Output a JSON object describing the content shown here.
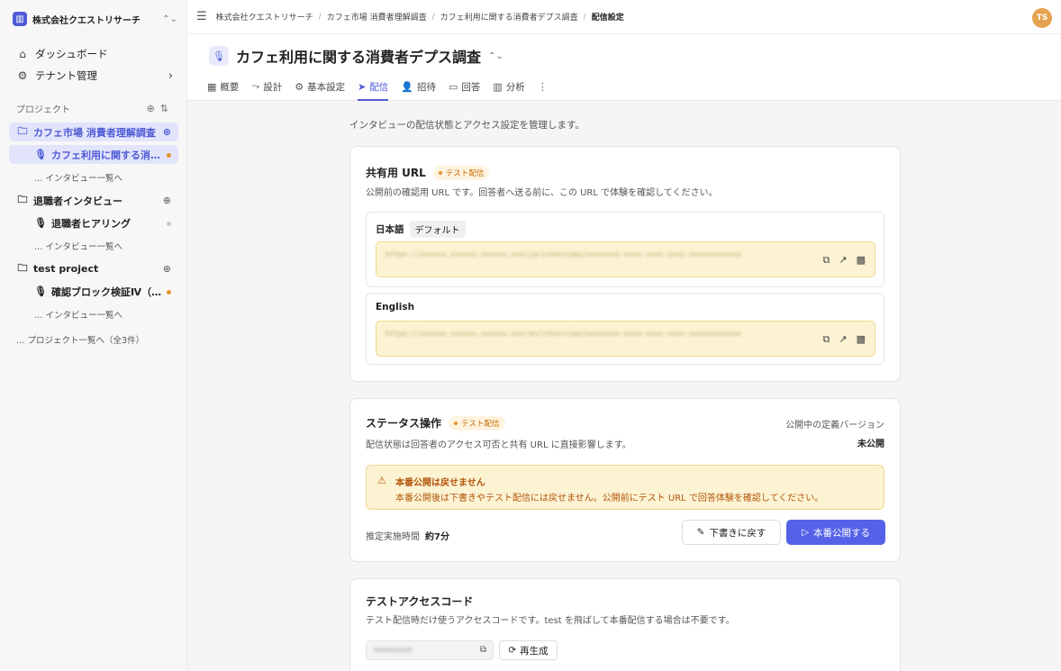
{
  "org": {
    "name": "株式会社クエストリサーチ"
  },
  "sidebar": {
    "nav": [
      {
        "label": "ダッシュボード"
      },
      {
        "label": "テナント管理"
      }
    ],
    "section_label": "プロジェクト",
    "projects": [
      {
        "label": "カフェ市場 消費者理解調査"
      },
      {
        "label": "カフェ利用に関する消…"
      },
      {
        "label": "… インタビュー一覧へ"
      },
      {
        "label": "退職者インタビュー"
      },
      {
        "label": "退職者ヒアリング"
      },
      {
        "label": "… インタビュー一覧へ"
      },
      {
        "label": "test project"
      },
      {
        "label": "確認ブロック検証Ⅳ（…"
      },
      {
        "label": "… インタビュー一覧へ"
      }
    ],
    "all_projects": "… プロジェクト一覧へ（全3件）"
  },
  "breadcrumb": [
    "株式会社クエストリサーチ",
    "カフェ市場 消費者理解調査",
    "カフェ利用に関する消費者デプス調査",
    "配信設定"
  ],
  "user": {
    "initials": "TS"
  },
  "page": {
    "title": "カフェ利用に関する消費者デプス調査",
    "tabs": [
      "概要",
      "設計",
      "基本設定",
      "配信",
      "招待",
      "回答",
      "分析"
    ],
    "active_tab": "配信",
    "description": "インタビューの配信状態とアクセス設定を管理します。"
  },
  "share_url": {
    "title": "共有用 URL",
    "badge": "テスト配信",
    "subtitle": "公開前の確認用 URL です。回答者へ送る前に、この URL で体験を確認してください。",
    "langs": [
      {
        "label": "日本語",
        "tag": "デフォルト",
        "url": "https://xxxxxx.xxxxxx.xxxxxx.xxx/ja/interview/xxxxxxxx-xxxx-xxxx-xxxx-xxxxxxxxxxxx"
      },
      {
        "label": "English",
        "tag": "",
        "url": "https://xxxxxx.xxxxxx.xxxxxx.xxx/en/interview/xxxxxxxx-xxxx-xxxx-xxxx-xxxxxxxxxxxx"
      }
    ]
  },
  "status": {
    "title": "ステータス操作",
    "badge": "テスト配信",
    "subtitle": "配信状態は回答者のアクセス可否と共有 URL に直接影響します。",
    "version_label": "公開中の定義バージョン",
    "version_value": "未公開",
    "warning_title": "本番公開は戻せません",
    "warning_body": "本番公開後は下書きやテスト配信には戻せません。公開前にテスト URL で回答体験を確認してください。",
    "est_label": "推定実施時間",
    "est_value": "約7分",
    "revert_button": "下書きに戻す",
    "publish_button": "本番公開する"
  },
  "access_code": {
    "title": "テストアクセスコード",
    "subtitle": "テスト配信時だけ使うアクセスコードです。test を飛ばして本番配信する場合は不要です。",
    "value": "xxxxxxxx",
    "regen_button": "再生成"
  },
  "colors": {
    "accent": "#4f5bd5",
    "primary_button": "#5562e8",
    "warning_bg": "#fcf3d3",
    "warning_text": "#b3540a",
    "badge_dot": "#e8912d"
  }
}
